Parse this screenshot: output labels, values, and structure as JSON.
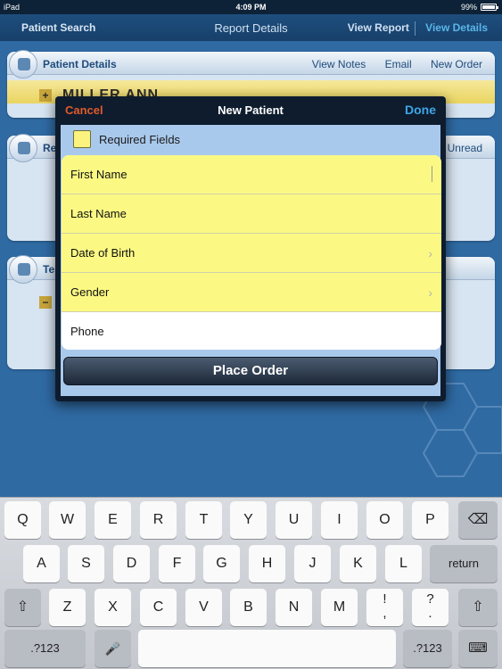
{
  "status_bar": {
    "device": "iPad",
    "time": "4:09 PM",
    "battery": "99%",
    "battery_level": 0.99
  },
  "nav": {
    "back": "Patient Search",
    "title": "Report Details",
    "view_report": "View Report",
    "view_details": "View Details"
  },
  "patient_panel": {
    "title": "Patient Details",
    "links": [
      "View Notes",
      "Email",
      "New Order"
    ],
    "patient_name": "MILLER ANN",
    "expand": "+"
  },
  "reports_panel": {
    "title": "Re",
    "unread": "Unread"
  },
  "tests_panel": {
    "title": "Tes",
    "collapse": "−"
  },
  "modal": {
    "cancel": "Cancel",
    "title": "New Patient",
    "done": "Done",
    "legend": "Required Fields",
    "fields": [
      {
        "label": "First Name",
        "required": true
      },
      {
        "label": "Last Name",
        "required": true
      },
      {
        "label": "Date of Birth",
        "required": true,
        "chevron": "›"
      },
      {
        "label": "Gender",
        "required": true,
        "chevron": "›"
      },
      {
        "label": "Phone",
        "required": false
      }
    ],
    "place_order": "Place Order"
  },
  "keyboard": {
    "row1": [
      "Q",
      "W",
      "E",
      "R",
      "T",
      "Y",
      "U",
      "I",
      "O",
      "P"
    ],
    "row2": [
      "A",
      "S",
      "D",
      "F",
      "G",
      "H",
      "J",
      "K",
      "L"
    ],
    "row3": [
      "Z",
      "X",
      "C",
      "V",
      "B",
      "N",
      "M"
    ],
    "punct1": {
      "top": "!",
      "bottom": ","
    },
    "punct2": {
      "top": "?",
      "bottom": "."
    },
    "return": "return",
    "numbers": ".?123",
    "backspace_icon": "⌫",
    "shift_icon": "⇧",
    "mic_icon": "🎤",
    "hide_icon": "⌨"
  }
}
